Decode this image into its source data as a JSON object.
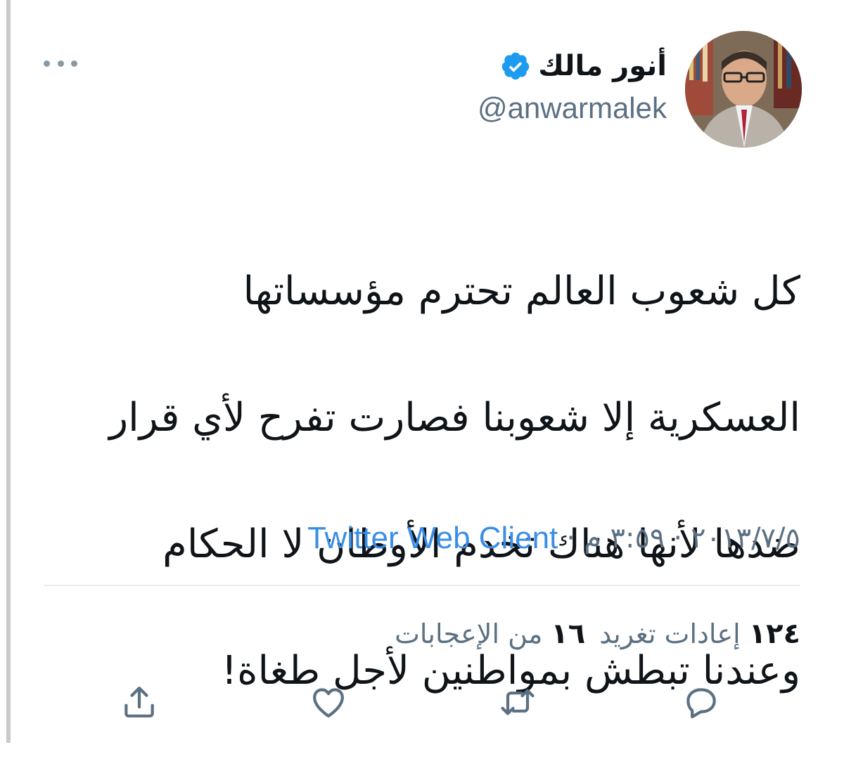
{
  "tweet": {
    "display_name": "أنور مالك",
    "handle": "@anwarmalek",
    "verified": true,
    "text_lines": [
      "كل شعوب العالم تحترم مؤسساتها",
      "العسكرية إلا شعوبنا فصارت تفرح لأي قرار",
      "ضدها لأنها هناك تخدم الأوطان لا الحكام",
      "وعندنا تبطش بمواطنين لأجل طغاة!"
    ],
    "date": "٢٠١٣/٧/٥",
    "separator": "·",
    "time": "٣:٥٩ م",
    "source": "Twitter Web Client"
  },
  "stats": {
    "retweets_count": "١٢٤",
    "retweets_label": "إعادات تغريد",
    "likes_count": "١٦",
    "likes_label": "من الإعجابات"
  },
  "icons": {
    "more": "more-horizontal-icon",
    "verified": "verified-badge-icon",
    "reply": "reply-icon",
    "retweet": "retweet-icon",
    "like": "heart-icon",
    "share": "share-icon"
  },
  "colors": {
    "accent": "#1d9bf0",
    "secondary_text": "#5b7083",
    "primary_text": "#0f1419",
    "divider": "#e6ecf0"
  }
}
